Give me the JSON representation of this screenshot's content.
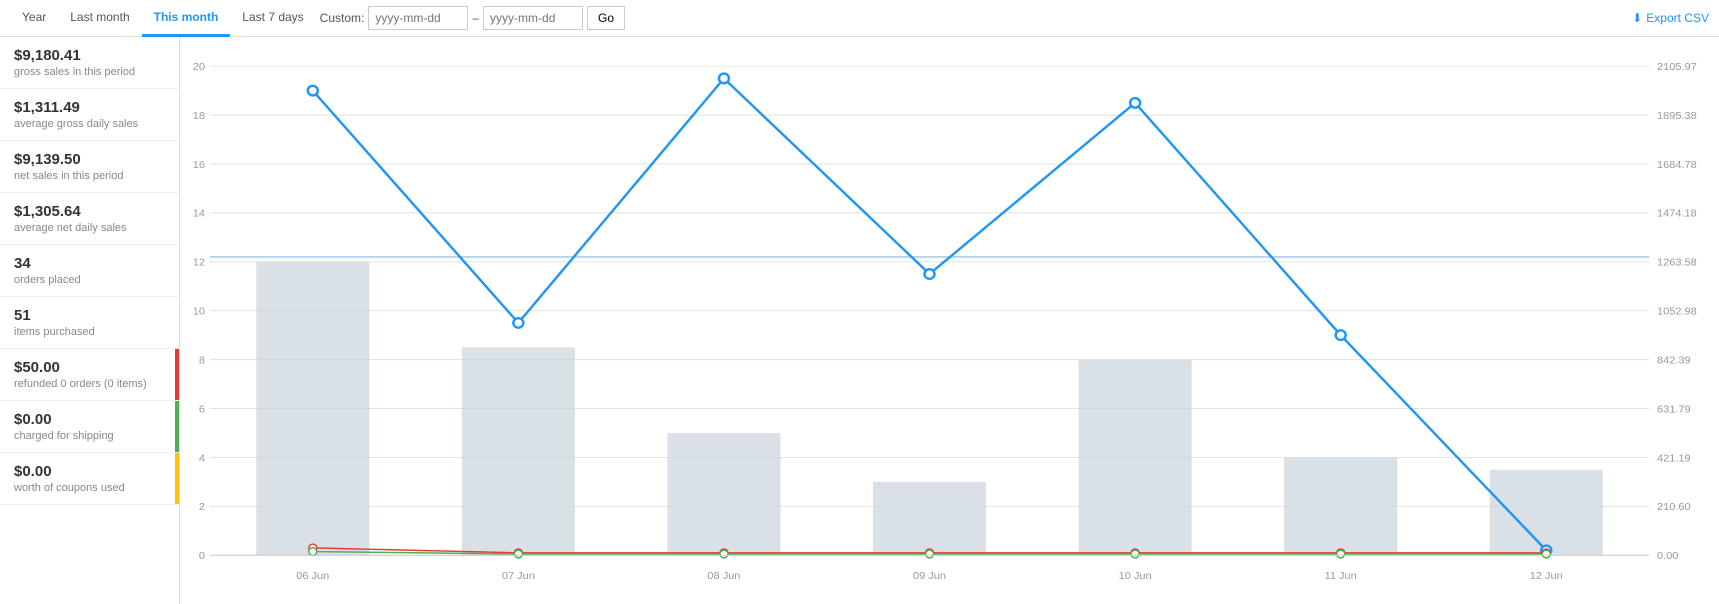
{
  "tabs": [
    {
      "label": "Year",
      "active": false
    },
    {
      "label": "Last month",
      "active": false
    },
    {
      "label": "This month",
      "active": true
    },
    {
      "label": "Last 7 days",
      "active": false
    }
  ],
  "custom": {
    "label": "Custom:",
    "from_placeholder": "yyyy-mm-dd",
    "to_placeholder": "yyyy-mm-dd",
    "dash": "–",
    "go_label": "Go"
  },
  "export_label": "Export CSV",
  "stats": [
    {
      "value": "$9,180.41",
      "label": "gross sales in this period",
      "color": null
    },
    {
      "value": "$1,311.49",
      "label": "average gross daily sales",
      "color": null
    },
    {
      "value": "$9,139.50",
      "label": "net sales in this period",
      "color": null
    },
    {
      "value": "$1,305.64",
      "label": "average net daily sales",
      "color": null
    },
    {
      "value": "34",
      "label": "orders placed",
      "color": null
    },
    {
      "value": "51",
      "label": "items purchased",
      "color": null
    },
    {
      "value": "$50.00",
      "label": "refunded 0 orders (0 items)",
      "color": "#e53935"
    },
    {
      "value": "$0.00",
      "label": "charged for shipping",
      "color": "#4caf50"
    },
    {
      "value": "$0.00",
      "label": "worth of coupons used",
      "color": "#ffc107"
    }
  ],
  "chart": {
    "xLabels": [
      "06 Jun",
      "07 Jun",
      "08 Jun",
      "09 Jun",
      "10 Jun",
      "11 Jun",
      "12 Jun"
    ],
    "yLabels": [
      0,
      2,
      4,
      6,
      8,
      10,
      12,
      14,
      16,
      18,
      20
    ],
    "yRight": [
      "0.00",
      "210.60",
      "421.19",
      "631.79",
      "842.39",
      "1052.98",
      "1263.58",
      "1474.18",
      "1684.78",
      "1895.38",
      "2105.97"
    ],
    "bars": [
      12,
      8.5,
      5,
      3,
      8,
      4,
      3.5
    ],
    "blueLine": [
      19,
      9.5,
      19.5,
      11.5,
      18.5,
      9,
      0.2
    ],
    "avgLine": 12.2,
    "redLine": [
      0.3,
      0.1,
      0.1,
      0.1,
      0.1,
      0.1,
      0.1
    ],
    "greenLine": [
      0.15,
      0.05,
      0.05,
      0.05,
      0.05,
      0.05,
      0.05
    ]
  }
}
